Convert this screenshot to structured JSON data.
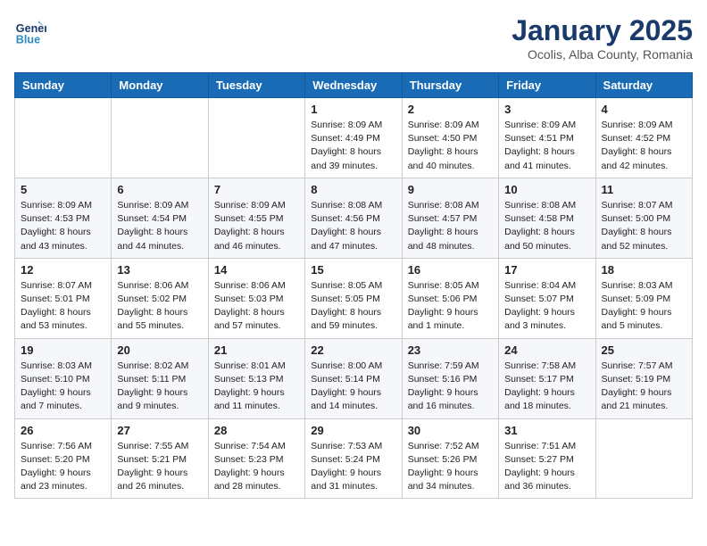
{
  "header": {
    "logo_line1": "General",
    "logo_line2": "Blue",
    "month": "January 2025",
    "location": "Ocolis, Alba County, Romania"
  },
  "weekdays": [
    "Sunday",
    "Monday",
    "Tuesday",
    "Wednesday",
    "Thursday",
    "Friday",
    "Saturday"
  ],
  "weeks": [
    [
      {
        "day": "",
        "info": ""
      },
      {
        "day": "",
        "info": ""
      },
      {
        "day": "",
        "info": ""
      },
      {
        "day": "1",
        "info": "Sunrise: 8:09 AM\nSunset: 4:49 PM\nDaylight: 8 hours\nand 39 minutes."
      },
      {
        "day": "2",
        "info": "Sunrise: 8:09 AM\nSunset: 4:50 PM\nDaylight: 8 hours\nand 40 minutes."
      },
      {
        "day": "3",
        "info": "Sunrise: 8:09 AM\nSunset: 4:51 PM\nDaylight: 8 hours\nand 41 minutes."
      },
      {
        "day": "4",
        "info": "Sunrise: 8:09 AM\nSunset: 4:52 PM\nDaylight: 8 hours\nand 42 minutes."
      }
    ],
    [
      {
        "day": "5",
        "info": "Sunrise: 8:09 AM\nSunset: 4:53 PM\nDaylight: 8 hours\nand 43 minutes."
      },
      {
        "day": "6",
        "info": "Sunrise: 8:09 AM\nSunset: 4:54 PM\nDaylight: 8 hours\nand 44 minutes."
      },
      {
        "day": "7",
        "info": "Sunrise: 8:09 AM\nSunset: 4:55 PM\nDaylight: 8 hours\nand 46 minutes."
      },
      {
        "day": "8",
        "info": "Sunrise: 8:08 AM\nSunset: 4:56 PM\nDaylight: 8 hours\nand 47 minutes."
      },
      {
        "day": "9",
        "info": "Sunrise: 8:08 AM\nSunset: 4:57 PM\nDaylight: 8 hours\nand 48 minutes."
      },
      {
        "day": "10",
        "info": "Sunrise: 8:08 AM\nSunset: 4:58 PM\nDaylight: 8 hours\nand 50 minutes."
      },
      {
        "day": "11",
        "info": "Sunrise: 8:07 AM\nSunset: 5:00 PM\nDaylight: 8 hours\nand 52 minutes."
      }
    ],
    [
      {
        "day": "12",
        "info": "Sunrise: 8:07 AM\nSunset: 5:01 PM\nDaylight: 8 hours\nand 53 minutes."
      },
      {
        "day": "13",
        "info": "Sunrise: 8:06 AM\nSunset: 5:02 PM\nDaylight: 8 hours\nand 55 minutes."
      },
      {
        "day": "14",
        "info": "Sunrise: 8:06 AM\nSunset: 5:03 PM\nDaylight: 8 hours\nand 57 minutes."
      },
      {
        "day": "15",
        "info": "Sunrise: 8:05 AM\nSunset: 5:05 PM\nDaylight: 8 hours\nand 59 minutes."
      },
      {
        "day": "16",
        "info": "Sunrise: 8:05 AM\nSunset: 5:06 PM\nDaylight: 9 hours\nand 1 minute."
      },
      {
        "day": "17",
        "info": "Sunrise: 8:04 AM\nSunset: 5:07 PM\nDaylight: 9 hours\nand 3 minutes."
      },
      {
        "day": "18",
        "info": "Sunrise: 8:03 AM\nSunset: 5:09 PM\nDaylight: 9 hours\nand 5 minutes."
      }
    ],
    [
      {
        "day": "19",
        "info": "Sunrise: 8:03 AM\nSunset: 5:10 PM\nDaylight: 9 hours\nand 7 minutes."
      },
      {
        "day": "20",
        "info": "Sunrise: 8:02 AM\nSunset: 5:11 PM\nDaylight: 9 hours\nand 9 minutes."
      },
      {
        "day": "21",
        "info": "Sunrise: 8:01 AM\nSunset: 5:13 PM\nDaylight: 9 hours\nand 11 minutes."
      },
      {
        "day": "22",
        "info": "Sunrise: 8:00 AM\nSunset: 5:14 PM\nDaylight: 9 hours\nand 14 minutes."
      },
      {
        "day": "23",
        "info": "Sunrise: 7:59 AM\nSunset: 5:16 PM\nDaylight: 9 hours\nand 16 minutes."
      },
      {
        "day": "24",
        "info": "Sunrise: 7:58 AM\nSunset: 5:17 PM\nDaylight: 9 hours\nand 18 minutes."
      },
      {
        "day": "25",
        "info": "Sunrise: 7:57 AM\nSunset: 5:19 PM\nDaylight: 9 hours\nand 21 minutes."
      }
    ],
    [
      {
        "day": "26",
        "info": "Sunrise: 7:56 AM\nSunset: 5:20 PM\nDaylight: 9 hours\nand 23 minutes."
      },
      {
        "day": "27",
        "info": "Sunrise: 7:55 AM\nSunset: 5:21 PM\nDaylight: 9 hours\nand 26 minutes."
      },
      {
        "day": "28",
        "info": "Sunrise: 7:54 AM\nSunset: 5:23 PM\nDaylight: 9 hours\nand 28 minutes."
      },
      {
        "day": "29",
        "info": "Sunrise: 7:53 AM\nSunset: 5:24 PM\nDaylight: 9 hours\nand 31 minutes."
      },
      {
        "day": "30",
        "info": "Sunrise: 7:52 AM\nSunset: 5:26 PM\nDaylight: 9 hours\nand 34 minutes."
      },
      {
        "day": "31",
        "info": "Sunrise: 7:51 AM\nSunset: 5:27 PM\nDaylight: 9 hours\nand 36 minutes."
      },
      {
        "day": "",
        "info": ""
      }
    ]
  ]
}
